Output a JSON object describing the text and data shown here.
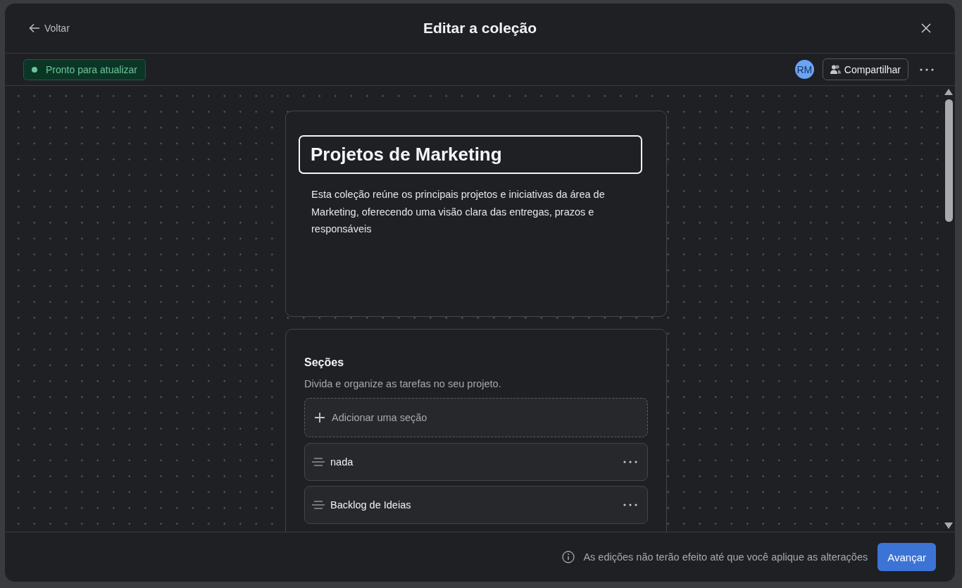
{
  "header": {
    "back": "Voltar",
    "title": "Editar a coleção"
  },
  "toolbar": {
    "status": "Pronto para atualizar",
    "avatar": "RM",
    "share": "Compartilhar"
  },
  "collection": {
    "name": "Projetos de Marketing",
    "focused": true,
    "description": "Esta coleção reúne os principais projetos e iniciativas da área de Marketing, oferecendo uma visão clara das entregas, prazos e responsáveis"
  },
  "sections": {
    "title": "Seções",
    "subtitle": "Divida e organize as tarefas no seu projeto.",
    "add": "Adicionar uma seção",
    "items": [
      {
        "name": "nada"
      },
      {
        "name": "Backlog de Ideias"
      }
    ]
  },
  "footer": {
    "note": "As edições não terão efeito até que você aplique as alterações",
    "button": "Avançar"
  }
}
